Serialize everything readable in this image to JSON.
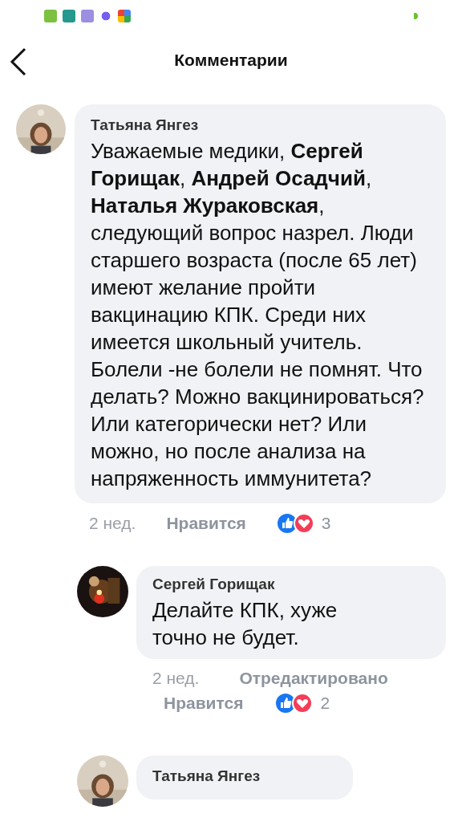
{
  "header": {
    "title": "Комментарии"
  },
  "comments": [
    {
      "author": "Татьяна Янгез",
      "text": "Уважаемые медики, **Сергей Горищак**, **Андрей Осадчий**, **Наталья Жураковская**, следующий вопрос назрел. Люди старшего возраста (после 65 лет) имеют желание пройти вакцинацию КПК. Среди них имеется школьный учитель. Болели -не болели не помнят.  Что делать? Можно вакцинироваться? Или категорически нет? Или можно, но после анализа на напряженность иммунитета?",
      "time": "2 нед.",
      "like_label": "Нравится",
      "reaction_count": "3",
      "replies": [
        {
          "author": "Сергей Горищак",
          "text": "Делайте КПК, хуже точно не будет.",
          "time": "2 нед.",
          "edited": "Отредактировано",
          "like_label": "Нравится",
          "reaction_count": "2"
        },
        {
          "author": "Татьяна Янгез"
        }
      ]
    }
  ]
}
